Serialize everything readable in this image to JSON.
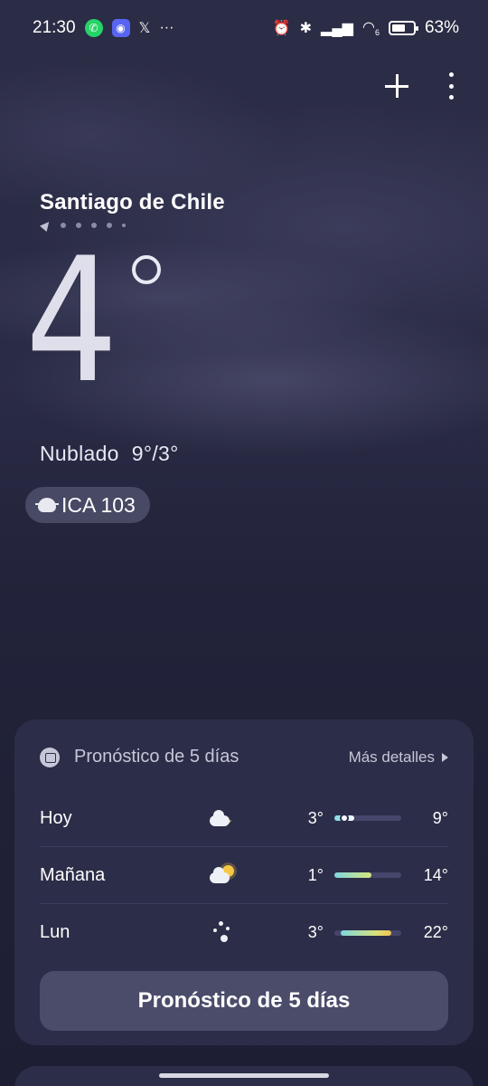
{
  "status_bar": {
    "time": "21:30",
    "notification_icons": [
      "whatsapp-icon",
      "discord-icon",
      "x-icon"
    ],
    "overflow": "···",
    "battery_percent": "63%",
    "battery_level": 0.63,
    "wifi_badge": "6"
  },
  "header": {
    "actions": [
      "add-icon",
      "more-icon"
    ]
  },
  "location": {
    "city": "Santiago de Chile",
    "page_count": 5
  },
  "current": {
    "temperature": "4",
    "condition": "Nublado",
    "high_low": "9°/3°",
    "aqi_label": "ICA 103"
  },
  "forecast_card": {
    "title": "Pronóstico de 5 días",
    "more_details": "Más detalles",
    "button_label": "Pronóstico de 5 días",
    "days": [
      {
        "day": "Hoy",
        "icon": "cloudy-night-icon",
        "low": "3°",
        "high": "9°",
        "bar_start": 0.0,
        "bar_end": 0.3,
        "current_marker": 0.15,
        "bar_color": "#ffffff"
      },
      {
        "day": "Mañana",
        "icon": "partly-cloudy-day-icon",
        "low": "1°",
        "high": "14°",
        "bar_start": 0.0,
        "bar_end": 0.55,
        "bar_color": "#8fe3cf"
      },
      {
        "day": "Lun",
        "icon": "clear-night-icon",
        "low": "3°",
        "high": "22°",
        "bar_start": 0.1,
        "bar_end": 0.85,
        "bar_color": "#d9e27a"
      }
    ]
  }
}
